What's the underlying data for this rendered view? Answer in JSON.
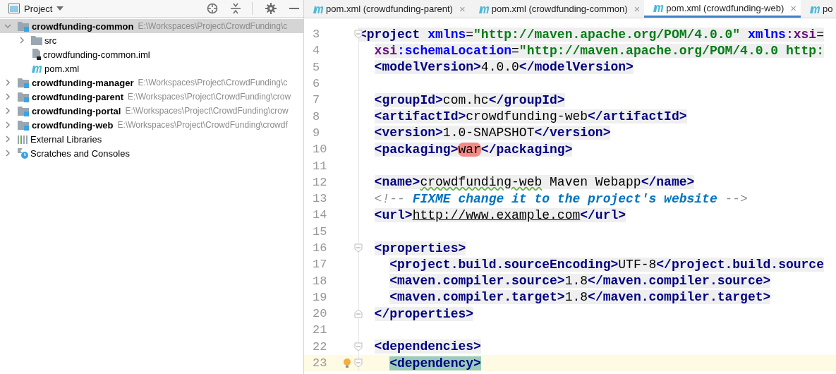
{
  "project_panel": {
    "title": "Project",
    "tree": [
      {
        "name": "crowdfunding-common",
        "path": "E:\\Workspaces\\Project\\CrowdFunding\\c",
        "kind": "module",
        "expanded": true,
        "selected": true,
        "children": [
          {
            "name": "src",
            "kind": "folder",
            "expanded": false,
            "selected": false
          },
          {
            "name": "crowdfunding-common.iml",
            "kind": "iml",
            "selected": false
          },
          {
            "name": "pom.xml",
            "kind": "maven",
            "selected": false
          }
        ]
      },
      {
        "name": "crowdfunding-manager",
        "path": "E:\\Workspaces\\Project\\CrowdFunding\\c",
        "kind": "module",
        "expanded": false,
        "selected": false
      },
      {
        "name": "crowdfunding-parent",
        "path": "E:\\Workspaces\\Project\\CrowdFunding\\crow",
        "kind": "module",
        "expanded": false,
        "selected": false
      },
      {
        "name": "crowdfunding-portal",
        "path": "E:\\Workspaces\\Project\\CrowdFunding\\crow",
        "kind": "module",
        "expanded": false,
        "selected": false
      },
      {
        "name": "crowdfunding-web",
        "path": "E:\\Workspaces\\Project\\CrowdFunding\\crowdf",
        "kind": "module",
        "expanded": false,
        "selected": false
      },
      {
        "name": "External Libraries",
        "kind": "libraries",
        "expanded": false,
        "selected": false
      },
      {
        "name": "Scratches and Consoles",
        "kind": "scratches",
        "expanded": false,
        "selected": false
      }
    ]
  },
  "editor": {
    "tabs": [
      {
        "label": "pom.xml (crowdfunding-parent)",
        "selected": false,
        "close": "×"
      },
      {
        "label": "pom.xml (crowdfunding-common)",
        "selected": false,
        "close": "×"
      },
      {
        "label": "pom.xml (crowdfunding-web)",
        "selected": true,
        "close": "×"
      },
      {
        "label": "po",
        "selected": false
      }
    ],
    "lines": [
      {
        "number": "3",
        "fold_open": true,
        "shaded": true,
        "tokens": [
          {
            "kind": "tag",
            "text": "<project"
          },
          {
            "kind": "attr",
            "text": " xmlns"
          },
          {
            "kind": "text",
            "text": "="
          },
          {
            "kind": "string",
            "text": "\"http://maven.apache.org/POM/4.0.0\""
          },
          {
            "kind": "attr",
            "text": " xmlns"
          },
          {
            "kind": "ns",
            "text": ":xsi"
          },
          {
            "kind": "text",
            "text": "="
          }
        ]
      },
      {
        "number": "4",
        "shaded": true,
        "tokens": [
          {
            "kind": "ns",
            "text": "  xsi"
          },
          {
            "kind": "attr",
            "text": ":schemaLocation"
          },
          {
            "kind": "text",
            "text": "="
          },
          {
            "kind": "string",
            "text": "\"http://maven.apache.org/POM/4.0.0 http:"
          }
        ]
      },
      {
        "number": "5",
        "shaded": true,
        "tokens": [
          {
            "kind": "tag",
            "text": "  <modelVersion>"
          },
          {
            "kind": "text",
            "text": "4.0.0"
          },
          {
            "kind": "tag",
            "text": "</modelVersion>"
          }
        ]
      },
      {
        "number": "6"
      },
      {
        "number": "7",
        "shaded": true,
        "tokens": [
          {
            "kind": "tag",
            "text": "  <groupId>"
          },
          {
            "kind": "text",
            "text": "com.hc"
          },
          {
            "kind": "tag",
            "text": "</groupId>"
          }
        ]
      },
      {
        "number": "8",
        "shaded": true,
        "tokens": [
          {
            "kind": "tag",
            "text": "  <artifactId>"
          },
          {
            "kind": "text",
            "text": "crowdfunding-web"
          },
          {
            "kind": "tag",
            "text": "</artifactId>"
          }
        ]
      },
      {
        "number": "9",
        "shaded": true,
        "tokens": [
          {
            "kind": "tag",
            "text": "  <version>"
          },
          {
            "kind": "text",
            "text": "1.0-SNAPSHOT"
          },
          {
            "kind": "tag",
            "text": "</version>"
          }
        ]
      },
      {
        "number": "10",
        "shaded": true,
        "tokens": [
          {
            "kind": "tag",
            "text": "  <packaging>"
          },
          {
            "kind": "error",
            "text": "war"
          },
          {
            "kind": "tag",
            "text": "</packaging>"
          }
        ]
      },
      {
        "number": "11"
      },
      {
        "number": "12",
        "shaded": true,
        "tokens": [
          {
            "kind": "tag",
            "text": "  <name>"
          },
          {
            "kind": "typo",
            "text": "crowdfunding-web"
          },
          {
            "kind": "text",
            "text": " Maven Webapp"
          },
          {
            "kind": "tag",
            "text": "</name>"
          }
        ]
      },
      {
        "number": "13",
        "tokens": [
          {
            "kind": "comment",
            "text": "  <!-- "
          },
          {
            "kind": "todo",
            "text": "FIXME change it to the project's website"
          },
          {
            "kind": "comment",
            "text": " -->"
          }
        ]
      },
      {
        "number": "14",
        "shaded": true,
        "tokens": [
          {
            "kind": "tag",
            "text": "  <url>"
          },
          {
            "kind": "link",
            "text": "http://www.example.com"
          },
          {
            "kind": "tag",
            "text": "</url>"
          }
        ]
      },
      {
        "number": "15"
      },
      {
        "number": "16",
        "fold_open": true,
        "shaded": true,
        "tokens": [
          {
            "kind": "tag",
            "text": "  <properties>"
          }
        ]
      },
      {
        "number": "17",
        "shaded": true,
        "tokens": [
          {
            "kind": "tag",
            "text": "    <project.build.sourceEncoding>"
          },
          {
            "kind": "text",
            "text": "UTF-8"
          },
          {
            "kind": "tag",
            "text": "</project.build.source"
          }
        ]
      },
      {
        "number": "18",
        "shaded": true,
        "tokens": [
          {
            "kind": "tag",
            "text": "    <maven.compiler.source>"
          },
          {
            "kind": "text",
            "text": "1.8"
          },
          {
            "kind": "tag",
            "text": "</maven.compiler.source>"
          }
        ]
      },
      {
        "number": "19",
        "shaded": true,
        "tokens": [
          {
            "kind": "tag",
            "text": "    <maven.compiler.target>"
          },
          {
            "kind": "text",
            "text": "1.8"
          },
          {
            "kind": "tag",
            "text": "</maven.compiler.target>"
          }
        ]
      },
      {
        "number": "20",
        "fold_close": true,
        "shaded": true,
        "tokens": [
          {
            "kind": "tag",
            "text": "  </properties>"
          }
        ]
      },
      {
        "number": "21"
      },
      {
        "number": "22",
        "fold_open": true,
        "shaded": true,
        "tokens": [
          {
            "kind": "tag",
            "text": "  <dependencies>"
          }
        ]
      },
      {
        "number": "23",
        "fold_open": true,
        "current": true,
        "bulb": true,
        "tokens": [
          {
            "kind": "match",
            "text": "    <dependency>"
          }
        ]
      }
    ]
  }
}
